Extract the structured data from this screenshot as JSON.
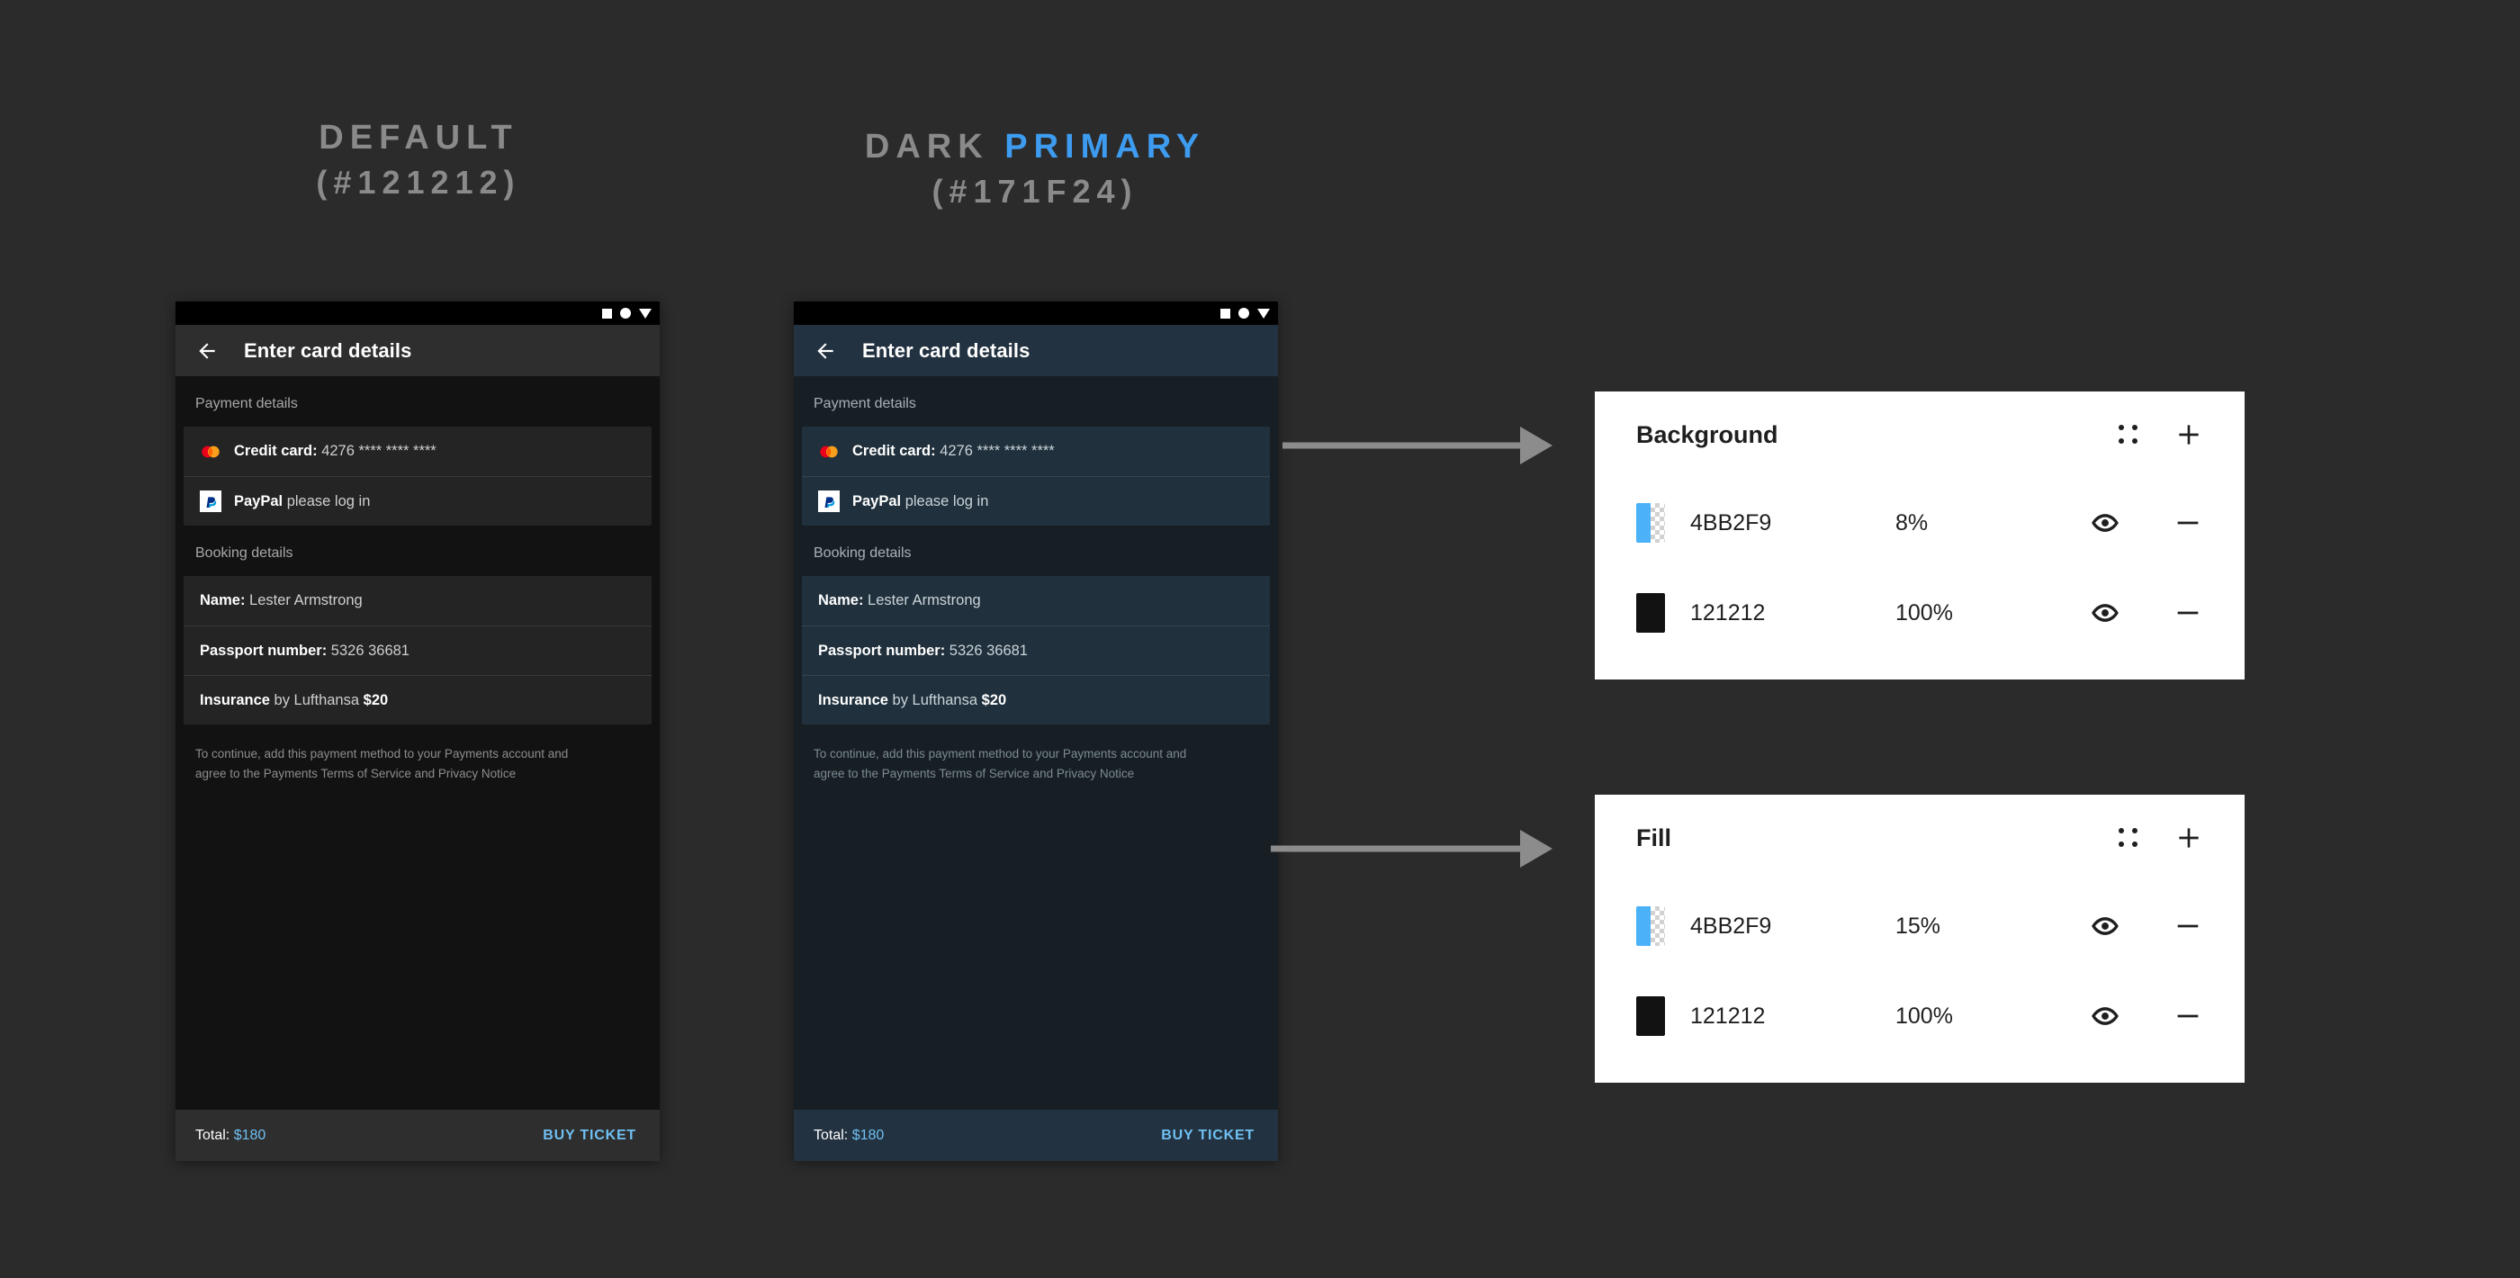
{
  "headings": {
    "default": {
      "line1": "DEFAULT",
      "line2": "(#121212)"
    },
    "dark": {
      "line1_plain": "DARK ",
      "line1_accent": "PRIMARY",
      "line2": "(#171F24)"
    }
  },
  "phone": {
    "appbar_title": "Enter card details",
    "section_payment": "Payment details",
    "section_booking": "Booking details",
    "rows": {
      "credit_card_label": "Credit card:",
      "credit_card_value": "4276 **** **** ****",
      "paypal_label": "PayPal",
      "paypal_value": "please log in",
      "name_label": "Name:",
      "name_value": "Lester Armstrong",
      "passport_label": "Passport number:",
      "passport_value": "5326 36681",
      "insurance_label": "Insurance",
      "insurance_by": "by Lufthansa",
      "insurance_price": "$20"
    },
    "disclaimer": "To continue, add this payment method to your Payments account and agree to the Payments Terms of Service and Privacy Notice",
    "total_label": "Total:",
    "total_amount": "$180",
    "buy_button": "BUY TICKET"
  },
  "panels": {
    "background": {
      "title": "Background",
      "rows": [
        {
          "hex": "4BB2F9",
          "opacity": "8%",
          "swatch_color": "#4BB2F9",
          "transparent": true
        },
        {
          "hex": "121212",
          "opacity": "100%",
          "swatch_color": "#121212",
          "transparent": false
        }
      ]
    },
    "fill": {
      "title": "Fill",
      "rows": [
        {
          "hex": "4BB2F9",
          "opacity": "15%",
          "swatch_color": "#4BB2F9",
          "transparent": true
        },
        {
          "hex": "121212",
          "opacity": "100%",
          "swatch_color": "#121212",
          "transparent": false
        }
      ]
    }
  },
  "colors": {
    "canvas": "#2B2B2B",
    "default_surface": "#121212",
    "dark_primary_surface": "#171F24",
    "accent_blue": "#4BB2F9",
    "link_blue": "#6FC0F2"
  }
}
